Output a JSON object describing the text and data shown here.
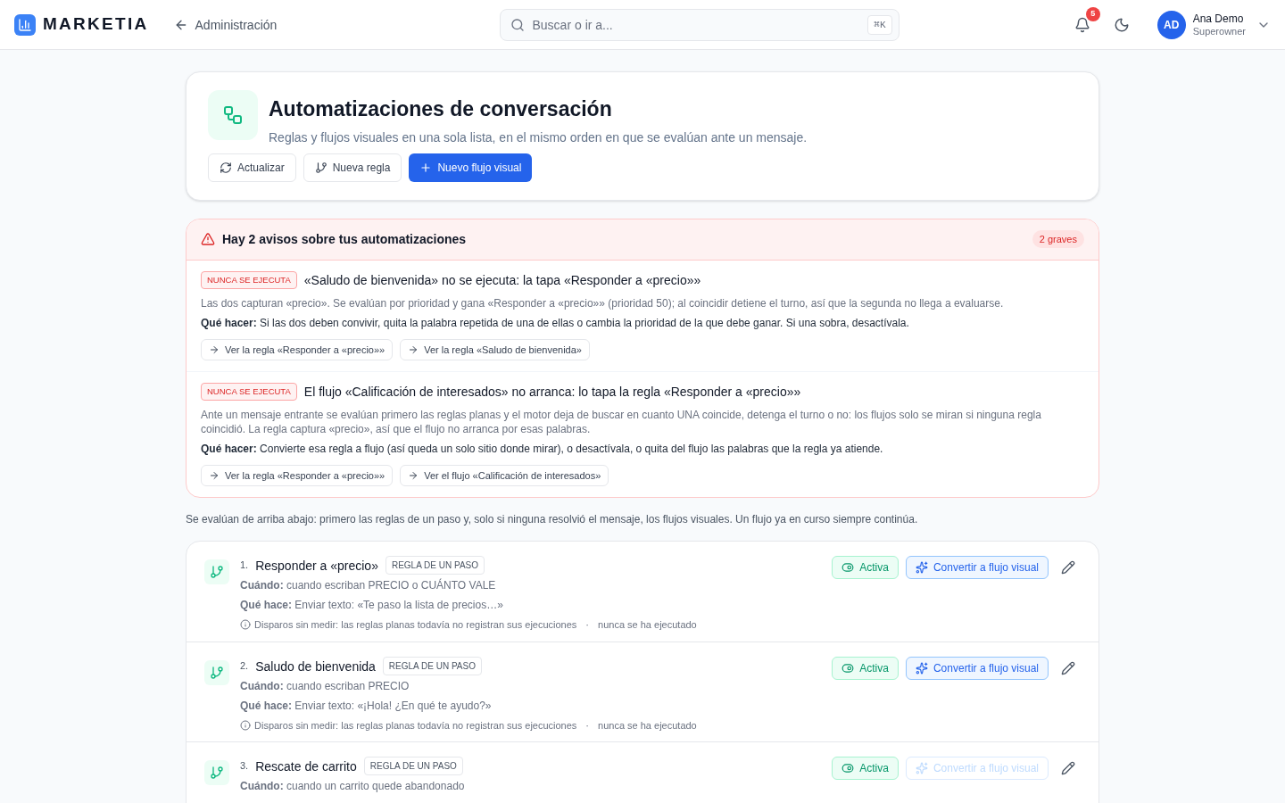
{
  "brand": "MARKETIA",
  "back_link": "Administración",
  "search": {
    "placeholder": "Buscar o ir a...",
    "shortcut": "⌘K"
  },
  "notifications": {
    "count": "5"
  },
  "user": {
    "initials": "AD",
    "name": "Ana Demo",
    "role": "Superowner"
  },
  "header": {
    "title": "Automatizaciones de conversación",
    "subtitle": "Reglas y flujos visuales en una sola lista, en el mismo orden en que se evalúan ante un mensaje.",
    "actions": [
      {
        "kind": "refresh",
        "label": "Actualizar",
        "primary": false
      },
      {
        "kind": "rule",
        "label": "Nueva regla",
        "primary": false
      },
      {
        "kind": "flow",
        "label": "Nuevo flujo visual",
        "primary": true
      }
    ]
  },
  "alerts": {
    "title": "Hay 2 avisos sobre tus automatizaciones",
    "badge": "2 graves",
    "items": [
      {
        "tag": "NUNCA SE EJECUTA",
        "title": "«Saludo de bienvenida» no se ejecuta: la tapa «Responder a «precio»»",
        "description": "Las dos capturan «precio». Se evalúan por prioridad y gana «Responder a «precio»» (prioridad 50); al coincidir detiene el turno, así que la segunda no llega a evaluarse.",
        "action": "**Qué hacer:** Si las dos deben convivir, quita la palabra repetida de una de ellas o cambia la prioridad de la que debe ganar. Si una sobra, desactívala.",
        "links": [
          "Ver la regla «Responder a «precio»»",
          "Ver la regla «Saludo de bienvenida»"
        ]
      },
      {
        "tag": "NUNCA SE EJECUTA",
        "title": "El flujo «Calificación de interesados» no arranca: lo tapa la regla «Responder a «precio»»",
        "description": "Ante un mensaje entrante se evalúan primero las reglas planas y el motor deja de buscar en cuanto UNA coincide, detenga el turno o no: los flujos solo se miran si ninguna regla coincidió. La regla captura «precio», así que el flujo no arranca por esas palabras.",
        "action": "**Qué hacer:** Convierte esa regla a flujo (así queda un solo sitio donde mirar), o desactívala, o quita del flujo las palabras que la regla ya atiende.",
        "links": [
          "Ver la regla «Responder a «precio»»",
          "Ver el flujo «Calificación de interesados»"
        ]
      }
    ]
  },
  "separator": "·",
  "order_note": "Se evalúan de arriba abajo: primero las reglas de un paso y, solo si ninguna resolvió el mensaje, los flujos visuales. Un flujo ya en curso siempre continúa.",
  "rules": [
    {
      "number": "1.",
      "name": "Responder a «precio»",
      "type": "REGLA DE UN PASO",
      "when": "**Cuándo:** cuando escriban PRECIO o CUÁNTO VALE",
      "does": "**Qué hace:** Enviar texto: «Te paso la lista de precios…»",
      "note": "Disparos sin medir: las reglas planas todavía no registran sus ejecuciones",
      "last_run": "nunca se ha ejecutado",
      "status": "Activa",
      "active": true,
      "convert": "Convertir a flujo visual",
      "convert_disabled": false
    },
    {
      "number": "2.",
      "name": "Saludo de bienvenida",
      "type": "REGLA DE UN PASO",
      "when": "**Cuándo:** cuando escriban PRECIO",
      "does": "**Qué hace:** Enviar texto: «¡Hola! ¿En qué te ayudo?»",
      "note": "Disparos sin medir: las reglas planas todavía no registran sus ejecuciones",
      "last_run": "nunca se ha ejecutado",
      "status": "Activa",
      "active": true,
      "convert": "Convertir a flujo visual",
      "convert_disabled": false
    },
    {
      "number": "3.",
      "name": "Rescate de carrito",
      "type": "REGLA DE UN PASO",
      "when": "**Cuándo:** cuando un carrito quede abandonado",
      "status": "Activa",
      "active": true,
      "convert": "Convertir a flujo visual",
      "convert_disabled": true
    }
  ]
}
